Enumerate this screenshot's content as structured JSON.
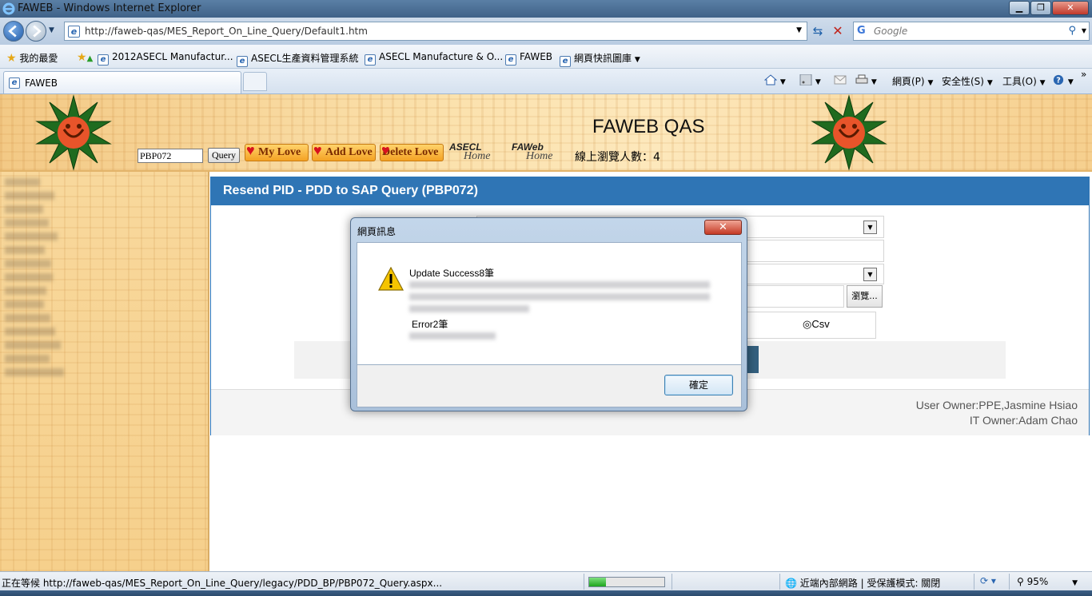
{
  "window": {
    "title": "FAWEB - Windows Internet Explorer",
    "buttons": {
      "minimize": "▁",
      "maximize": "❐",
      "close": "✕"
    }
  },
  "address_bar": {
    "url": "http://faweb-qas/MES_Report_On_Line_Query/Default1.htm",
    "search_placeholder": "Google",
    "search_logo": "G"
  },
  "favorites": {
    "label": "我的最愛",
    "items": [
      "2012ASECL Manufactur...",
      "ASECL生產資料管理系統",
      "ASECL Manufacture & O...",
      "FAWEB",
      "網頁快訊圖庫"
    ]
  },
  "tabs": [
    {
      "label": "FAWEB"
    }
  ],
  "command_bar": {
    "page": "網頁(P)",
    "safety": "安全性(S)",
    "tools": "工具(O)"
  },
  "banner": {
    "site_title": "FAWEB QAS",
    "query_value": "PBP072",
    "query_button": "Query",
    "my_love": "My Love",
    "add_love": "Add Love",
    "delete_love": "Delete Love",
    "asecl_home": {
      "brand": "ASECL",
      "home": "Home"
    },
    "faweb_home": {
      "brand": "FAWeb",
      "home": "Home"
    },
    "online_users": "線上瀏覽人數：4"
  },
  "content": {
    "header": "Resend PID - PDD to SAP Query (PBP072)",
    "browse_button": "瀏覽...",
    "csv_option": "◎Csv",
    "footer": {
      "user_owner": "User Owner:PPE,Jasmine Hsiao",
      "it_owner": "IT Owner:Adam Chao"
    }
  },
  "dialog": {
    "title": "網頁訊息",
    "close": "✕",
    "message_success": "Update Success8筆",
    "message_error": "Error2筆",
    "ok_button": "確定"
  },
  "status_bar": {
    "text": "正在等候 http://faweb-qas/MES_Report_On_Line_Query/legacy/PDD_BP/PBP072_Query.aspx...",
    "progress_fraction": 0.22,
    "zone": "近端內部網路 | 受保護模式: 關閉",
    "zoom": "95%"
  },
  "colors": {
    "header_blue": "#2f75b5",
    "banner_gold": "#fbe1ac"
  }
}
